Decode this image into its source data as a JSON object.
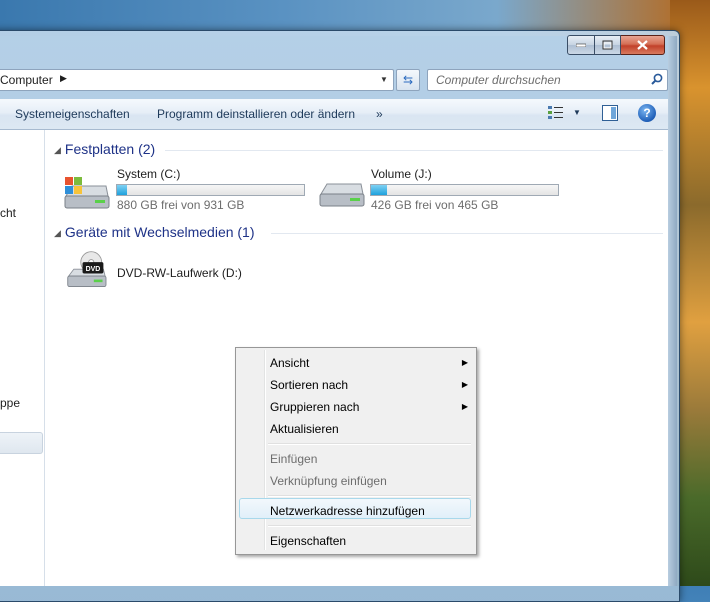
{
  "address": {
    "location": "Computer"
  },
  "search": {
    "placeholder": "Computer durchsuchen"
  },
  "toolbar": {
    "system_properties": "Systemeigenschaften",
    "uninstall": "Programm deinstallieren oder ändern",
    "more": "»"
  },
  "nav": {
    "partial_1": "cht",
    "partial_2": "ppe"
  },
  "groups": {
    "hard_disks": {
      "title": "Festplatten (2)",
      "drives": [
        {
          "name": "System (C:)",
          "free_text": "880 GB frei von 931 GB",
          "used_fraction": 0.055
        },
        {
          "name": "Volume (J:)",
          "free_text": "426 GB frei von 465 GB",
          "used_fraction": 0.084
        }
      ]
    },
    "removable": {
      "title": "Geräte mit Wechselmedien (1)",
      "drives": [
        {
          "name": "DVD-RW-Laufwerk (D:)",
          "badge": "DVD"
        }
      ]
    }
  },
  "context_menu": {
    "items": [
      {
        "label": "Ansicht",
        "submenu": true,
        "disabled": false
      },
      {
        "label": "Sortieren nach",
        "submenu": true,
        "disabled": false
      },
      {
        "label": "Gruppieren nach",
        "submenu": true,
        "disabled": false
      },
      {
        "label": "Aktualisieren",
        "submenu": false,
        "disabled": false
      },
      {
        "label": "Einfügen",
        "submenu": false,
        "disabled": true
      },
      {
        "label": "Verknüpfung einfügen",
        "submenu": false,
        "disabled": true
      },
      {
        "label": "Netzwerkadresse hinzufügen",
        "submenu": false,
        "disabled": false,
        "highlighted": true
      },
      {
        "label": "Eigenschaften",
        "submenu": false,
        "disabled": false
      }
    ]
  },
  "colors": {
    "group_header": "#1e3287",
    "drive_fill": "#1ea1dc",
    "menu_bg": "#f0f0f0",
    "close_button": "#c2412a"
  }
}
